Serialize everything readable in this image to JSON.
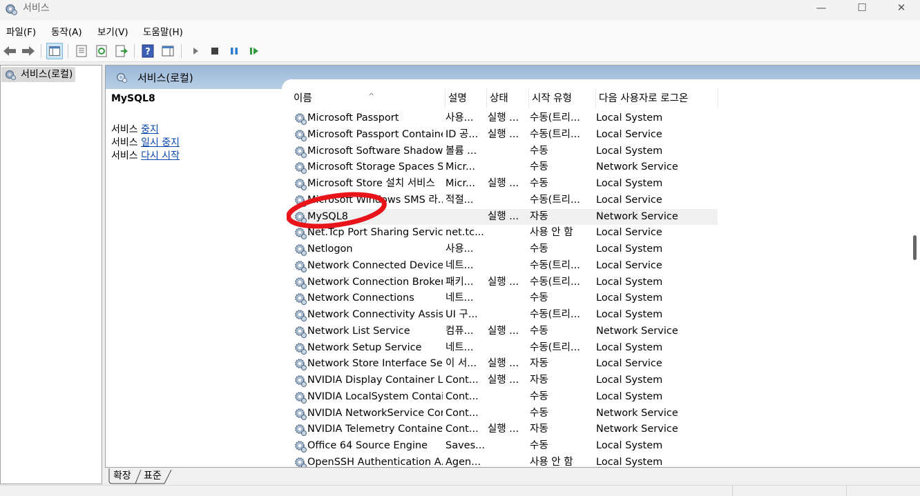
{
  "window": {
    "title": "서비스",
    "min_label": "—",
    "max_label": "☐",
    "close_label": "✕"
  },
  "menu": [
    "파일(F)",
    "동작(A)",
    "보기(V)",
    "도움말(H)"
  ],
  "tree": {
    "root_label": "서비스(로컬)"
  },
  "pane": {
    "header": "서비스(로컬)"
  },
  "detail": {
    "service_name": "MySQL8",
    "action_prefix": "서비스",
    "actions": [
      "중지",
      "일시 중지",
      "다시 시작"
    ]
  },
  "columns": [
    "이름",
    "설명",
    "상태",
    "시작 유형",
    "다음 사용자로 로그온"
  ],
  "rows": [
    {
      "name": "Microsoft Passport",
      "desc": "사용...",
      "status": "실행 ...",
      "startup": "수동(트리...",
      "logon": "Local System"
    },
    {
      "name": "Microsoft Passport Container",
      "desc": "ID 공...",
      "status": "실행 ...",
      "startup": "수동(트리...",
      "logon": "Local Service"
    },
    {
      "name": "Microsoft Software Shadow...",
      "desc": "볼륨 ...",
      "status": "",
      "startup": "수동",
      "logon": "Local System"
    },
    {
      "name": "Microsoft Storage Spaces S...",
      "desc": "Micr...",
      "status": "",
      "startup": "수동",
      "logon": "Network Service"
    },
    {
      "name": "Microsoft Store 설치 서비스",
      "desc": "Micr...",
      "status": "실행 ...",
      "startup": "수동",
      "logon": "Local System"
    },
    {
      "name": "Microsoft Windows SMS 라...",
      "desc": "적절...",
      "status": "",
      "startup": "수동(트리...",
      "logon": "Local Service"
    },
    {
      "name": "MySQL8",
      "desc": "",
      "status": "실행 ...",
      "startup": "자동",
      "logon": "Network Service"
    },
    {
      "name": "Net.Tcp Port Sharing Service",
      "desc": "net.tc...",
      "status": "",
      "startup": "사용 안 함",
      "logon": "Local Service"
    },
    {
      "name": "Netlogon",
      "desc": "사용...",
      "status": "",
      "startup": "수동",
      "logon": "Local System"
    },
    {
      "name": "Network Connected Devices...",
      "desc": "네트...",
      "status": "",
      "startup": "수동(트리...",
      "logon": "Local Service"
    },
    {
      "name": "Network Connection Broker",
      "desc": "패키...",
      "status": "실행 ...",
      "startup": "수동(트리...",
      "logon": "Local System"
    },
    {
      "name": "Network Connections",
      "desc": "네트...",
      "status": "",
      "startup": "수동",
      "logon": "Local System"
    },
    {
      "name": "Network Connectivity Assist...",
      "desc": "UI 구...",
      "status": "",
      "startup": "수동(트리...",
      "logon": "Local System"
    },
    {
      "name": "Network List Service",
      "desc": "컴퓨...",
      "status": "실행 ...",
      "startup": "수동",
      "logon": "Network Service"
    },
    {
      "name": "Network Setup Service",
      "desc": "네트...",
      "status": "",
      "startup": "수동(트리...",
      "logon": "Local System"
    },
    {
      "name": "Network Store Interface Ser...",
      "desc": "이 서...",
      "status": "실행 ...",
      "startup": "자동",
      "logon": "Local Service"
    },
    {
      "name": "NVIDIA Display Container LS",
      "desc": "Cont...",
      "status": "실행 ...",
      "startup": "자동",
      "logon": "Local System"
    },
    {
      "name": "NVIDIA LocalSystem Contai...",
      "desc": "Cont...",
      "status": "",
      "startup": "수동",
      "logon": "Local System"
    },
    {
      "name": "NVIDIA NetworkService Con...",
      "desc": "Cont...",
      "status": "",
      "startup": "수동",
      "logon": "Network Service"
    },
    {
      "name": "NVIDIA Telemetry Container",
      "desc": "Cont...",
      "status": "실행 ...",
      "startup": "자동",
      "logon": "Network Service"
    },
    {
      "name": "Office 64 Source Engine",
      "desc": "Saves...",
      "status": "",
      "startup": "수동",
      "logon": "Local System"
    },
    {
      "name": "OpenSSH Authentication A...",
      "desc": "Agen...",
      "status": "",
      "startup": "사용 안 함",
      "logon": "Local System"
    }
  ],
  "selected_row": 6,
  "tabs": [
    "확장",
    "표준"
  ],
  "colors": {
    "header_blue": "#9ab8d8",
    "annotation_red": "#e8141a",
    "link": "#0645ad"
  }
}
